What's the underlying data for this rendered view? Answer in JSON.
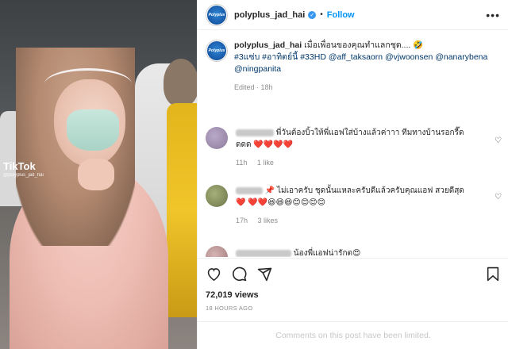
{
  "header": {
    "username": "polyplus_jad_hai",
    "follow_label": "Follow",
    "more_glyph": "•••"
  },
  "media": {
    "watermark_brand": "TikTok",
    "watermark_handle": "@polyplus_jad_hai"
  },
  "avatar_text": "Polyplus",
  "caption": {
    "username": "polyplus_jad_hai",
    "text": "เมื่อเพื่อนของคุณทำแลกชุด.... 🤣",
    "tags": [
      "#3แซ่บ",
      "#อาทิตย์นี้",
      "#33HD",
      "@aff_taksaorn",
      "@vjwoonsen",
      "@nanarybena",
      "@ningpanita"
    ],
    "edited": "Edited · 18h"
  },
  "comments": [
    {
      "text": "พี่วันต้องบิ้วให้พี่แอฟใส่บ้างแล้วค่าาา ทีมทางบ้านรอกรี๊ดดดด ❤️❤️❤️❤️",
      "time": "11h",
      "likes": "1 like"
    },
    {
      "text": "📌 ไม่เอาครับ ชุดนั้นแหละครับดีแล้วครับคุณแอฟ สวยดีสุด❤️ ❤️❤️😆😆😆😊😊😊😊",
      "time": "17h",
      "likes": "3 likes"
    },
    {
      "text": "น้องพี่แอฟน่ารักต😍"
    }
  ],
  "actions": {
    "views": "72,019 views",
    "time_ago": "18 HOURS AGO"
  },
  "footer": {
    "limited_text": "Comments on this post have been limited."
  },
  "colors": {
    "link_blue": "#0095f6",
    "tag_blue": "#00376b",
    "muted": "#8e8e8e"
  }
}
